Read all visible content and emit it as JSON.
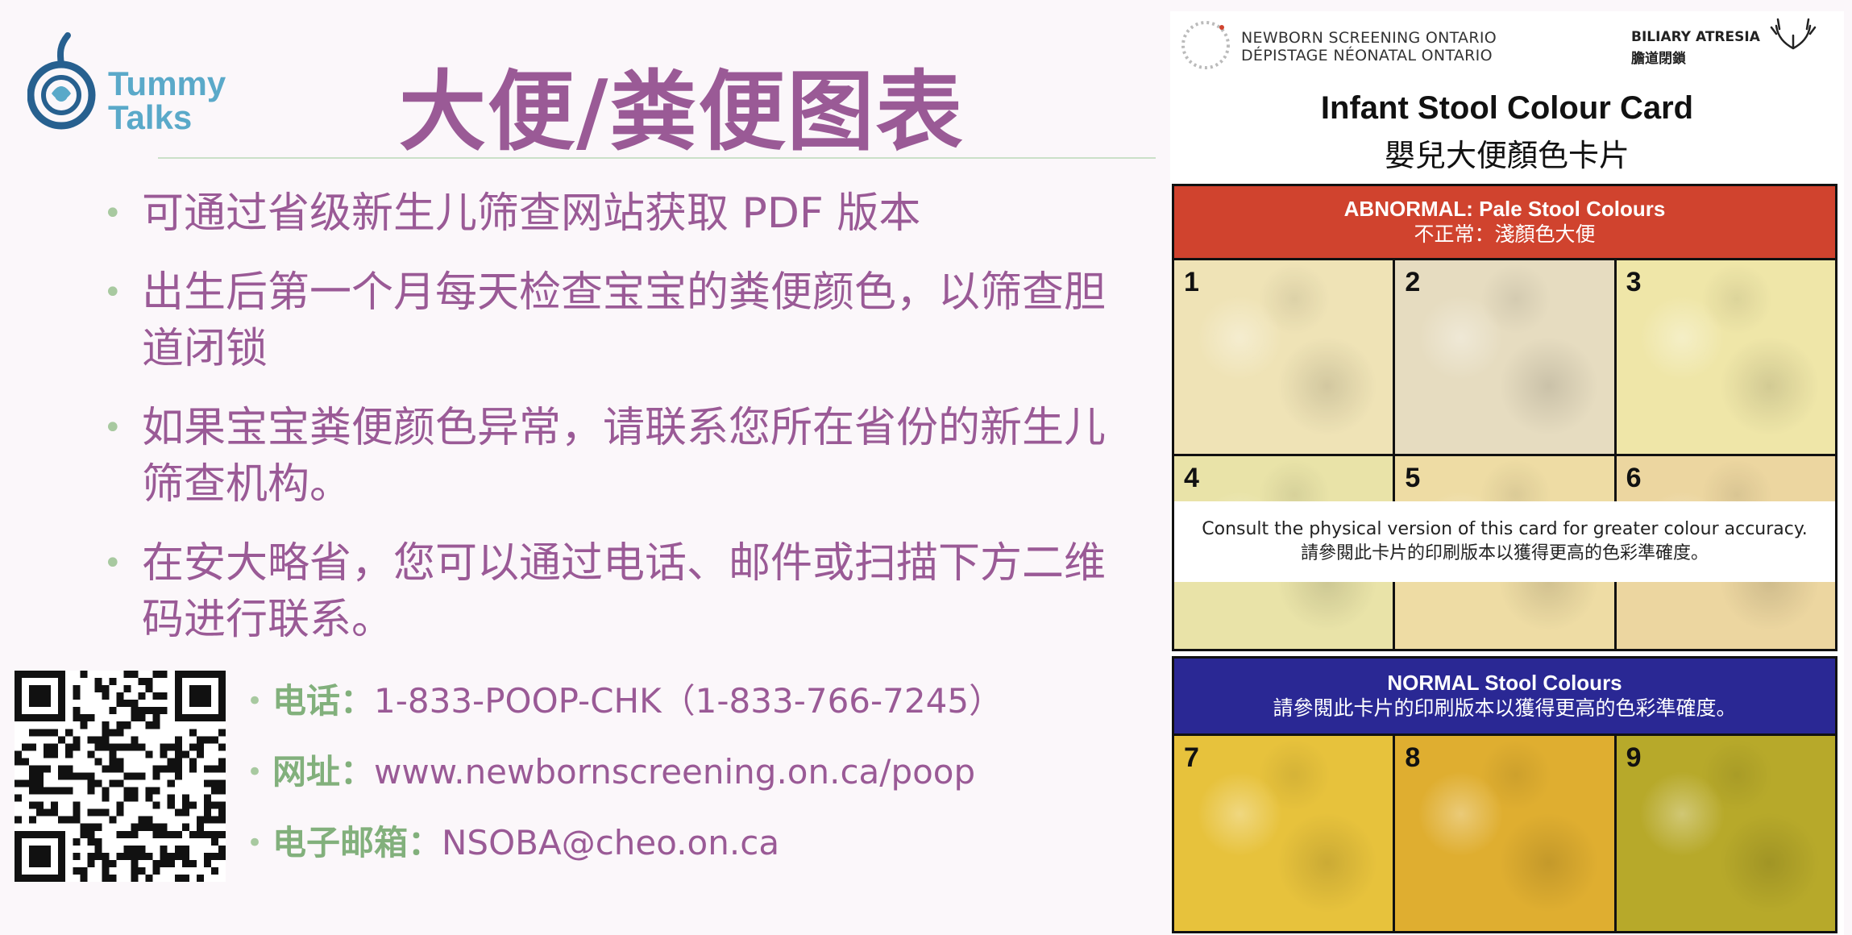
{
  "logo": {
    "line1": "Tummy",
    "line2": "Talks"
  },
  "title": "大便/粪便图表",
  "bullets": [
    "可通过省级新生儿筛查网站获取 PDF 版本",
    "出生后第一个月每天检查宝宝的粪便颜色，以筛查胆道闭锁",
    "如果宝宝粪便颜色异常，请联系您所在省份的新生儿筛查机构。",
    "在安大略省，您可以通过电话、邮件或扫描下方二维码进行联系。"
  ],
  "contacts": [
    {
      "label": "电话：",
      "value": "1-833-POOP-CHK（1-833-766-7245）"
    },
    {
      "label": "网址：",
      "value": "www.newbornscreening.on.ca/poop"
    },
    {
      "label": "电子邮箱：",
      "value": "NSOBA@cheo.on.ca"
    }
  ],
  "card": {
    "org_line1": "NEWBORN SCREENING ONTARIO",
    "org_line2": "DÉPISTAGE NÉONATAL ONTARIO",
    "ba_line1": "BILIARY ATRESIA",
    "ba_line2": "膽道閉鎖",
    "title": "Infant Stool Colour Card",
    "subtitle": "嬰兒大便顏色卡片",
    "abnormal": {
      "heading": "ABNORMAL: Pale Stool Colours",
      "subheading": "不正常：淺顏色大便"
    },
    "consult_en": "Consult the physical version of this card for greater colour accuracy.",
    "consult_zh": "請參閱此卡片的印刷版本以獲得更高的色彩準確度。",
    "normal": {
      "heading": "NORMAL Stool Colours",
      "subheading": "請參閱此卡片的印刷版本以獲得更高的色彩準確度。"
    },
    "swatches": [
      {
        "num": "1",
        "color": "#efe3b6"
      },
      {
        "num": "2",
        "color": "#e6dcc0"
      },
      {
        "num": "3",
        "color": "#efe6a8"
      },
      {
        "num": "4",
        "color": "#e9e3a8"
      },
      {
        "num": "5",
        "color": "#eedca4"
      },
      {
        "num": "6",
        "color": "#ecd6a0"
      },
      {
        "num": "7",
        "color": "#e7c23c"
      },
      {
        "num": "8",
        "color": "#dfae30"
      },
      {
        "num": "9",
        "color": "#b7a92a"
      }
    ]
  },
  "colors": {
    "purple": "#9a5a96",
    "green": "#82b07c",
    "abnormal_red": "#d0432e",
    "normal_blue": "#2a2894"
  }
}
